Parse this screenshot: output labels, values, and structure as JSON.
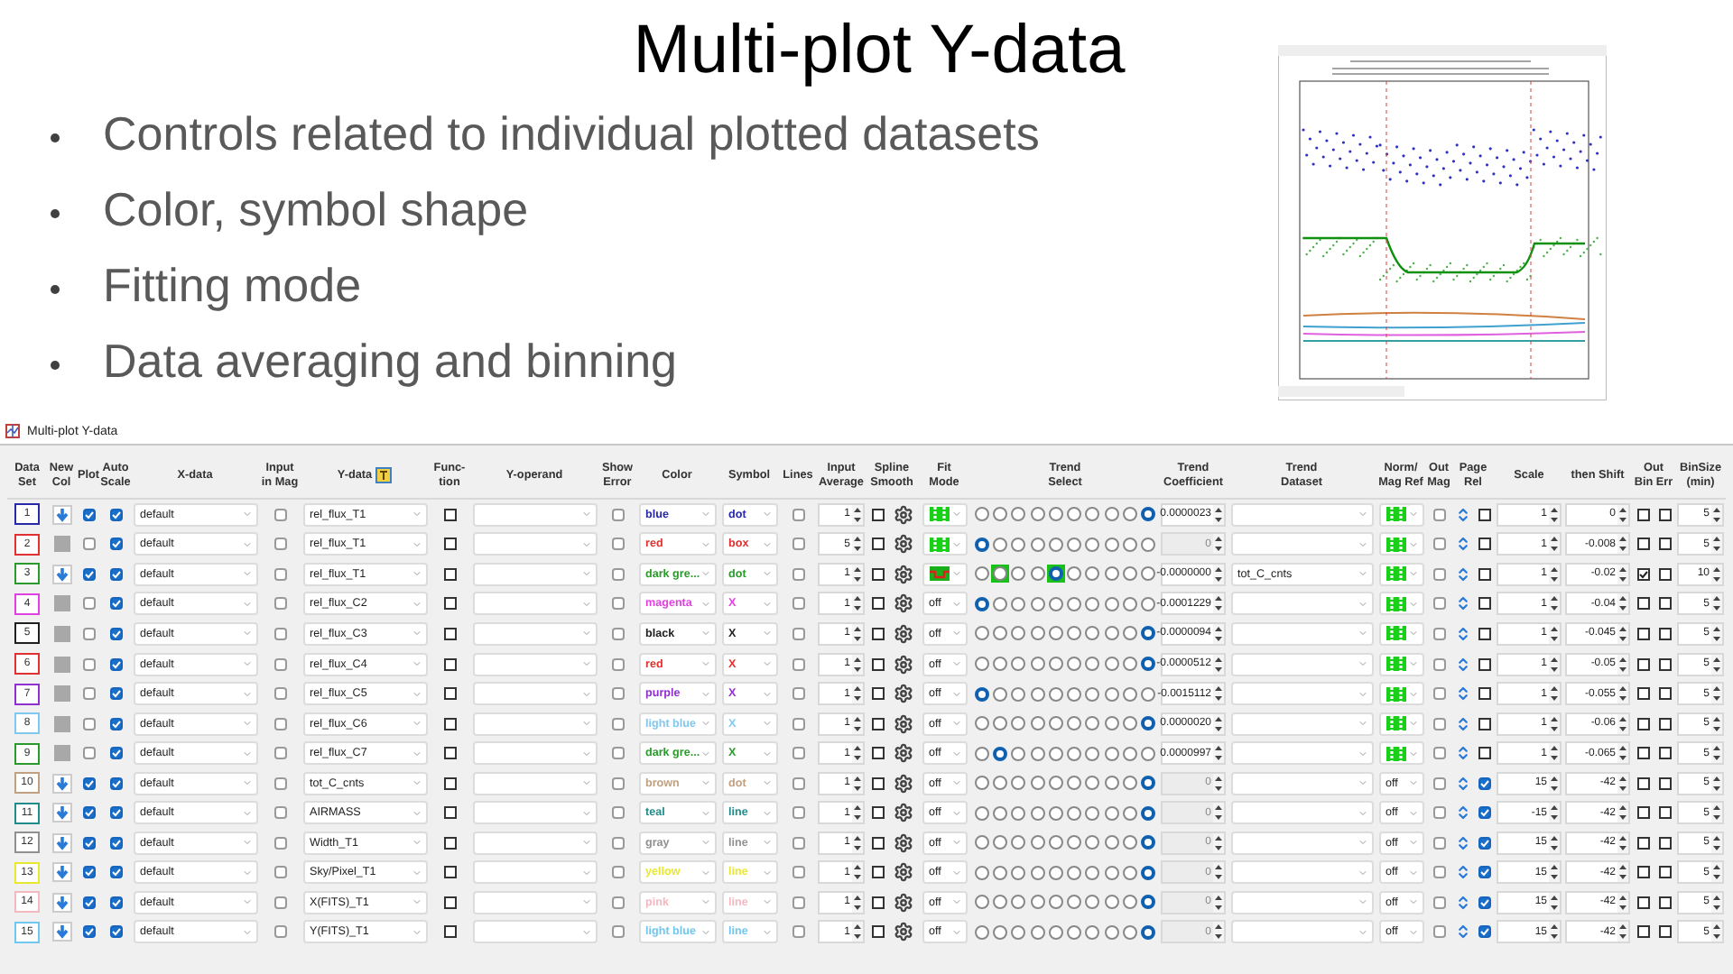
{
  "slide": {
    "title": "Multi-plot Y-data",
    "bullets": [
      "Controls related to individual plotted datasets",
      "Color, symbol shape",
      "Fitting mode",
      "Data averaging and binning"
    ]
  },
  "window": {
    "title": "Multi-plot Y-data"
  },
  "headers": [
    "Data\nSet",
    "New\nCol",
    "Plot",
    "Auto\nScale",
    "X-data",
    "Input\nin Mag",
    "Y-data",
    "Func-\ntion",
    "Y-operand",
    "Show\nError",
    "Color",
    "Symbol",
    "Lines",
    "Input\nAverage",
    "Spline\nSmooth",
    "Fit\nMode",
    "Trend\nSelect",
    "Trend\nCoefficient",
    "Trend\nDataset",
    "Norm/\nMag Ref",
    "Out\nMag",
    "Page\nRel",
    "Scale",
    "then Shift",
    "Out\nBin Err",
    "BinSize\n(min)"
  ],
  "rows": [
    {
      "set": "1",
      "color": "#2828a8",
      "new_col": true,
      "plot": true,
      "auto_scale": true,
      "x_data": "default",
      "in_mag": false,
      "y_data": "rel_flux_T1",
      "function": false,
      "show_error": false,
      "color_name": "blue",
      "symbol": "dot",
      "lines": false,
      "average": "1",
      "spline": false,
      "fit_mode": {
        "kind": "bars"
      },
      "trend": [
        {
          "selected": false,
          "highlighted": false
        },
        {
          "selected": false,
          "highlighted": false
        },
        {
          "selected": false,
          "highlighted": false
        },
        {
          "selected": false,
          "highlighted": false
        },
        {
          "selected": false,
          "highlighted": false
        },
        {
          "selected": false,
          "highlighted": false
        },
        {
          "selected": false,
          "highlighted": false
        },
        {
          "selected": false,
          "highlighted": false
        },
        {
          "selected": false,
          "highlighted": false
        },
        {
          "selected": true,
          "highlighted": false
        }
      ],
      "coefficient": "0.0000023",
      "coefficient_disabled": false,
      "norm": {
        "kind": "bars"
      },
      "out_mag": false,
      "page_rel": false,
      "scale": "1",
      "shift": "0",
      "out_bin": false,
      "bin_err": false,
      "bin_size": "5"
    },
    {
      "set": "2",
      "color": "#e03030",
      "new_col": false,
      "plot": false,
      "auto_scale": true,
      "x_data": "default",
      "in_mag": false,
      "y_data": "rel_flux_T1",
      "function": false,
      "show_error": false,
      "color_name": "red",
      "symbol": "box",
      "lines": false,
      "average": "5",
      "spline": false,
      "fit_mode": {
        "kind": "bars"
      },
      "trend": [
        {
          "selected": true,
          "highlighted": false
        },
        {
          "selected": false,
          "highlighted": false
        },
        {
          "selected": false,
          "highlighted": false
        },
        {
          "selected": false,
          "highlighted": false
        },
        {
          "selected": false,
          "highlighted": false
        },
        {
          "selected": false,
          "highlighted": false
        },
        {
          "selected": false,
          "highlighted": false
        },
        {
          "selected": false,
          "highlighted": false
        },
        {
          "selected": false,
          "highlighted": false
        },
        {
          "selected": false,
          "highlighted": false
        }
      ],
      "coefficient": "0",
      "coefficient_disabled": true,
      "norm": {
        "kind": "bars"
      },
      "out_mag": false,
      "page_rel": false,
      "scale": "1",
      "shift": "-0.008",
      "out_bin": false,
      "bin_err": false,
      "bin_size": "5"
    },
    {
      "set": "3",
      "color": "#2a9a2a",
      "new_col": true,
      "plot": true,
      "auto_scale": true,
      "x_data": "default",
      "in_mag": false,
      "y_data": "rel_flux_T1",
      "function": false,
      "show_error": false,
      "color_name": "dark gre...",
      "symbol": "dot",
      "lines": false,
      "average": "1",
      "spline": false,
      "fit_mode": {
        "kind": "step"
      },
      "trend": [
        {
          "selected": false,
          "highlighted": false
        },
        {
          "selected": false,
          "highlighted": true
        },
        {
          "selected": false,
          "highlighted": false
        },
        {
          "selected": false,
          "highlighted": false
        },
        {
          "selected": true,
          "highlighted": true
        },
        {
          "selected": false,
          "highlighted": false
        },
        {
          "selected": false,
          "highlighted": false
        },
        {
          "selected": false,
          "highlighted": false
        },
        {
          "selected": false,
          "highlighted": false
        },
        {
          "selected": false,
          "highlighted": false
        }
      ],
      "coefficient": "-0.0000000",
      "coefficient_disabled": false,
      "trend_dataset": "tot_C_cnts",
      "norm": {
        "kind": "bars"
      },
      "out_mag": false,
      "page_rel": false,
      "scale": "1",
      "shift": "-0.02",
      "out_bin": true,
      "bin_err": false,
      "bin_size": "10"
    },
    {
      "set": "4",
      "color": "#e040e0",
      "new_col": false,
      "plot": false,
      "auto_scale": true,
      "x_data": "default",
      "in_mag": false,
      "y_data": "rel_flux_C2",
      "function": false,
      "show_error": false,
      "color_name": "magenta",
      "symbol": "X",
      "lines": false,
      "average": "1",
      "spline": false,
      "fit_mode": {
        "kind": "text",
        "text": "off"
      },
      "trend": [
        {
          "selected": true,
          "highlighted": false
        },
        {
          "selected": false,
          "highlighted": false
        },
        {
          "selected": false,
          "highlighted": false
        },
        {
          "selected": false,
          "highlighted": false
        },
        {
          "selected": false,
          "highlighted": false
        },
        {
          "selected": false,
          "highlighted": false
        },
        {
          "selected": false,
          "highlighted": false
        },
        {
          "selected": false,
          "highlighted": false
        },
        {
          "selected": false,
          "highlighted": false
        },
        {
          "selected": false,
          "highlighted": false
        }
      ],
      "coefficient": "-0.0001229",
      "coefficient_disabled": false,
      "norm": {
        "kind": "bars"
      },
      "out_mag": false,
      "page_rel": false,
      "scale": "1",
      "shift": "-0.04",
      "out_bin": false,
      "bin_err": false,
      "bin_size": "5"
    },
    {
      "set": "5",
      "color": "#202020",
      "new_col": false,
      "plot": false,
      "auto_scale": true,
      "x_data": "default",
      "in_mag": false,
      "y_data": "rel_flux_C3",
      "function": false,
      "show_error": false,
      "color_name": "black",
      "symbol": "X",
      "lines": false,
      "average": "1",
      "spline": false,
      "fit_mode": {
        "kind": "text",
        "text": "off"
      },
      "trend": [
        {
          "selected": false,
          "highlighted": false
        },
        {
          "selected": false,
          "highlighted": false
        },
        {
          "selected": false,
          "highlighted": false
        },
        {
          "selected": false,
          "highlighted": false
        },
        {
          "selected": false,
          "highlighted": false
        },
        {
          "selected": false,
          "highlighted": false
        },
        {
          "selected": false,
          "highlighted": false
        },
        {
          "selected": false,
          "highlighted": false
        },
        {
          "selected": false,
          "highlighted": false
        },
        {
          "selected": true,
          "highlighted": false
        }
      ],
      "coefficient": "-0.0000094",
      "coefficient_disabled": false,
      "norm": {
        "kind": "bars"
      },
      "out_mag": false,
      "page_rel": false,
      "scale": "1",
      "shift": "-0.045",
      "out_bin": false,
      "bin_err": false,
      "bin_size": "5"
    },
    {
      "set": "6",
      "color": "#e03030",
      "new_col": false,
      "plot": false,
      "auto_scale": true,
      "x_data": "default",
      "in_mag": false,
      "y_data": "rel_flux_C4",
      "function": false,
      "show_error": false,
      "color_name": "red",
      "symbol": "X",
      "lines": false,
      "average": "1",
      "spline": false,
      "fit_mode": {
        "kind": "text",
        "text": "off"
      },
      "trend": [
        {
          "selected": false,
          "highlighted": false
        },
        {
          "selected": false,
          "highlighted": false
        },
        {
          "selected": false,
          "highlighted": false
        },
        {
          "selected": false,
          "highlighted": false
        },
        {
          "selected": false,
          "highlighted": false
        },
        {
          "selected": false,
          "highlighted": false
        },
        {
          "selected": false,
          "highlighted": false
        },
        {
          "selected": false,
          "highlighted": false
        },
        {
          "selected": false,
          "highlighted": false
        },
        {
          "selected": true,
          "highlighted": false
        }
      ],
      "coefficient": "-0.0000512",
      "coefficient_disabled": false,
      "norm": {
        "kind": "bars"
      },
      "out_mag": false,
      "page_rel": false,
      "scale": "1",
      "shift": "-0.05",
      "out_bin": false,
      "bin_err": false,
      "bin_size": "5"
    },
    {
      "set": "7",
      "color": "#9030d0",
      "new_col": false,
      "plot": false,
      "auto_scale": true,
      "x_data": "default",
      "in_mag": false,
      "y_data": "rel_flux_C5",
      "function": false,
      "show_error": false,
      "color_name": "purple",
      "symbol": "X",
      "lines": false,
      "average": "1",
      "spline": false,
      "fit_mode": {
        "kind": "text",
        "text": "off"
      },
      "trend": [
        {
          "selected": true,
          "highlighted": false
        },
        {
          "selected": false,
          "highlighted": false
        },
        {
          "selected": false,
          "highlighted": false
        },
        {
          "selected": false,
          "highlighted": false
        },
        {
          "selected": false,
          "highlighted": false
        },
        {
          "selected": false,
          "highlighted": false
        },
        {
          "selected": false,
          "highlighted": false
        },
        {
          "selected": false,
          "highlighted": false
        },
        {
          "selected": false,
          "highlighted": false
        },
        {
          "selected": false,
          "highlighted": false
        }
      ],
      "coefficient": "-0.0015112",
      "coefficient_disabled": false,
      "norm": {
        "kind": "bars"
      },
      "out_mag": false,
      "page_rel": false,
      "scale": "1",
      "shift": "-0.055",
      "out_bin": false,
      "bin_err": false,
      "bin_size": "5"
    },
    {
      "set": "8",
      "color": "#80c8f0",
      "new_col": false,
      "plot": false,
      "auto_scale": true,
      "x_data": "default",
      "in_mag": false,
      "y_data": "rel_flux_C6",
      "function": false,
      "show_error": false,
      "color_name": "light blue",
      "symbol": "X",
      "lines": false,
      "average": "1",
      "spline": false,
      "fit_mode": {
        "kind": "text",
        "text": "off"
      },
      "trend": [
        {
          "selected": false,
          "highlighted": false
        },
        {
          "selected": false,
          "highlighted": false
        },
        {
          "selected": false,
          "highlighted": false
        },
        {
          "selected": false,
          "highlighted": false
        },
        {
          "selected": false,
          "highlighted": false
        },
        {
          "selected": false,
          "highlighted": false
        },
        {
          "selected": false,
          "highlighted": false
        },
        {
          "selected": false,
          "highlighted": false
        },
        {
          "selected": false,
          "highlighted": false
        },
        {
          "selected": true,
          "highlighted": false
        }
      ],
      "coefficient": "0.0000020",
      "coefficient_disabled": false,
      "norm": {
        "kind": "bars"
      },
      "out_mag": false,
      "page_rel": false,
      "scale": "1",
      "shift": "-0.06",
      "out_bin": false,
      "bin_err": false,
      "bin_size": "5"
    },
    {
      "set": "9",
      "color": "#2a9a2a",
      "new_col": false,
      "plot": false,
      "auto_scale": true,
      "x_data": "default",
      "in_mag": false,
      "y_data": "rel_flux_C7",
      "function": false,
      "show_error": false,
      "color_name": "dark gre...",
      "symbol": "X",
      "lines": false,
      "average": "1",
      "spline": false,
      "fit_mode": {
        "kind": "text",
        "text": "off"
      },
      "trend": [
        {
          "selected": false,
          "highlighted": false
        },
        {
          "selected": true,
          "highlighted": false
        },
        {
          "selected": false,
          "highlighted": false
        },
        {
          "selected": false,
          "highlighted": false
        },
        {
          "selected": false,
          "highlighted": false
        },
        {
          "selected": false,
          "highlighted": false
        },
        {
          "selected": false,
          "highlighted": false
        },
        {
          "selected": false,
          "highlighted": false
        },
        {
          "selected": false,
          "highlighted": false
        },
        {
          "selected": false,
          "highlighted": false
        }
      ],
      "coefficient": "0.0000997",
      "coefficient_disabled": false,
      "norm": {
        "kind": "bars"
      },
      "out_mag": false,
      "page_rel": false,
      "scale": "1",
      "shift": "-0.065",
      "out_bin": false,
      "bin_err": false,
      "bin_size": "5"
    },
    {
      "set": "10",
      "color": "#c0a080",
      "new_col": true,
      "plot": true,
      "auto_scale": true,
      "x_data": "default",
      "in_mag": false,
      "y_data": "tot_C_cnts",
      "function": false,
      "show_error": false,
      "color_name": "brown",
      "symbol": "dot",
      "lines": false,
      "average": "1",
      "spline": false,
      "fit_mode": {
        "kind": "text",
        "text": "off"
      },
      "trend": [
        {
          "selected": false,
          "highlighted": false
        },
        {
          "selected": false,
          "highlighted": false
        },
        {
          "selected": false,
          "highlighted": false
        },
        {
          "selected": false,
          "highlighted": false
        },
        {
          "selected": false,
          "highlighted": false
        },
        {
          "selected": false,
          "highlighted": false
        },
        {
          "selected": false,
          "highlighted": false
        },
        {
          "selected": false,
          "highlighted": false
        },
        {
          "selected": false,
          "highlighted": false
        },
        {
          "selected": true,
          "highlighted": false
        }
      ],
      "coefficient": "0",
      "coefficient_disabled": true,
      "norm": {
        "kind": "text",
        "text": "off"
      },
      "out_mag": false,
      "page_rel": true,
      "scale": "15",
      "shift": "-42",
      "out_bin": false,
      "bin_err": false,
      "bin_size": "5"
    },
    {
      "set": "11",
      "color": "#208c8c",
      "new_col": true,
      "plot": true,
      "auto_scale": true,
      "x_data": "default",
      "in_mag": false,
      "y_data": "AIRMASS",
      "function": false,
      "show_error": false,
      "color_name": "teal",
      "symbol": "line",
      "lines": false,
      "average": "1",
      "spline": false,
      "fit_mode": {
        "kind": "text",
        "text": "off"
      },
      "trend": [
        {
          "selected": false,
          "highlighted": false
        },
        {
          "selected": false,
          "highlighted": false
        },
        {
          "selected": false,
          "highlighted": false
        },
        {
          "selected": false,
          "highlighted": false
        },
        {
          "selected": false,
          "highlighted": false
        },
        {
          "selected": false,
          "highlighted": false
        },
        {
          "selected": false,
          "highlighted": false
        },
        {
          "selected": false,
          "highlighted": false
        },
        {
          "selected": false,
          "highlighted": false
        },
        {
          "selected": true,
          "highlighted": false
        }
      ],
      "coefficient": "0",
      "coefficient_disabled": true,
      "norm": {
        "kind": "text",
        "text": "off"
      },
      "out_mag": false,
      "page_rel": true,
      "scale": "-15",
      "shift": "-42",
      "out_bin": false,
      "bin_err": false,
      "bin_size": "5"
    },
    {
      "set": "12",
      "color": "#909090",
      "new_col": true,
      "plot": true,
      "auto_scale": true,
      "x_data": "default",
      "in_mag": false,
      "y_data": "Width_T1",
      "function": false,
      "show_error": false,
      "color_name": "gray",
      "symbol": "line",
      "lines": false,
      "average": "1",
      "spline": false,
      "fit_mode": {
        "kind": "text",
        "text": "off"
      },
      "trend": [
        {
          "selected": false,
          "highlighted": false
        },
        {
          "selected": false,
          "highlighted": false
        },
        {
          "selected": false,
          "highlighted": false
        },
        {
          "selected": false,
          "highlighted": false
        },
        {
          "selected": false,
          "highlighted": false
        },
        {
          "selected": false,
          "highlighted": false
        },
        {
          "selected": false,
          "highlighted": false
        },
        {
          "selected": false,
          "highlighted": false
        },
        {
          "selected": false,
          "highlighted": false
        },
        {
          "selected": true,
          "highlighted": false
        }
      ],
      "coefficient": "0",
      "coefficient_disabled": true,
      "norm": {
        "kind": "text",
        "text": "off"
      },
      "out_mag": false,
      "page_rel": true,
      "scale": "15",
      "shift": "-42",
      "out_bin": false,
      "bin_err": false,
      "bin_size": "5"
    },
    {
      "set": "13",
      "color": "#e8e830",
      "new_col": true,
      "plot": true,
      "auto_scale": true,
      "x_data": "default",
      "in_mag": false,
      "y_data": "Sky/Pixel_T1",
      "function": false,
      "show_error": false,
      "color_name": "yellow",
      "symbol": "line",
      "lines": false,
      "average": "1",
      "spline": false,
      "fit_mode": {
        "kind": "text",
        "text": "off"
      },
      "trend": [
        {
          "selected": false,
          "highlighted": false
        },
        {
          "selected": false,
          "highlighted": false
        },
        {
          "selected": false,
          "highlighted": false
        },
        {
          "selected": false,
          "highlighted": false
        },
        {
          "selected": false,
          "highlighted": false
        },
        {
          "selected": false,
          "highlighted": false
        },
        {
          "selected": false,
          "highlighted": false
        },
        {
          "selected": false,
          "highlighted": false
        },
        {
          "selected": false,
          "highlighted": false
        },
        {
          "selected": true,
          "highlighted": false
        }
      ],
      "coefficient": "0",
      "coefficient_disabled": true,
      "norm": {
        "kind": "text",
        "text": "off"
      },
      "out_mag": false,
      "page_rel": true,
      "scale": "15",
      "shift": "-42",
      "out_bin": false,
      "bin_err": false,
      "bin_size": "5"
    },
    {
      "set": "14",
      "color": "#f4b8c0",
      "new_col": true,
      "plot": true,
      "auto_scale": true,
      "x_data": "default",
      "in_mag": false,
      "y_data": "X(FITS)_T1",
      "function": false,
      "show_error": false,
      "color_name": "pink",
      "symbol": "line",
      "lines": false,
      "average": "1",
      "spline": false,
      "fit_mode": {
        "kind": "text",
        "text": "off"
      },
      "trend": [
        {
          "selected": false,
          "highlighted": false
        },
        {
          "selected": false,
          "highlighted": false
        },
        {
          "selected": false,
          "highlighted": false
        },
        {
          "selected": false,
          "highlighted": false
        },
        {
          "selected": false,
          "highlighted": false
        },
        {
          "selected": false,
          "highlighted": false
        },
        {
          "selected": false,
          "highlighted": false
        },
        {
          "selected": false,
          "highlighted": false
        },
        {
          "selected": false,
          "highlighted": false
        },
        {
          "selected": true,
          "highlighted": false
        }
      ],
      "coefficient": "0",
      "coefficient_disabled": true,
      "norm": {
        "kind": "text",
        "text": "off"
      },
      "out_mag": false,
      "page_rel": true,
      "scale": "15",
      "shift": "-42",
      "out_bin": false,
      "bin_err": false,
      "bin_size": "5"
    },
    {
      "set": "15",
      "color": "#70c8f0",
      "new_col": true,
      "plot": true,
      "auto_scale": true,
      "x_data": "default",
      "in_mag": false,
      "y_data": "Y(FITS)_T1",
      "function": false,
      "show_error": false,
      "color_name": "light blue",
      "symbol": "line",
      "lines": false,
      "average": "1",
      "spline": false,
      "fit_mode": {
        "kind": "text",
        "text": "off"
      },
      "trend": [
        {
          "selected": false,
          "highlighted": false
        },
        {
          "selected": false,
          "highlighted": false
        },
        {
          "selected": false,
          "highlighted": false
        },
        {
          "selected": false,
          "highlighted": false
        },
        {
          "selected": false,
          "highlighted": false
        },
        {
          "selected": false,
          "highlighted": false
        },
        {
          "selected": false,
          "highlighted": false
        },
        {
          "selected": false,
          "highlighted": false
        },
        {
          "selected": false,
          "highlighted": false
        },
        {
          "selected": true,
          "highlighted": false
        }
      ],
      "coefficient": "0",
      "coefficient_disabled": true,
      "norm": {
        "kind": "text",
        "text": "off"
      },
      "out_mag": false,
      "page_rel": true,
      "scale": "15",
      "shift": "-42",
      "out_bin": false,
      "bin_err": false,
      "bin_size": "5"
    }
  ]
}
